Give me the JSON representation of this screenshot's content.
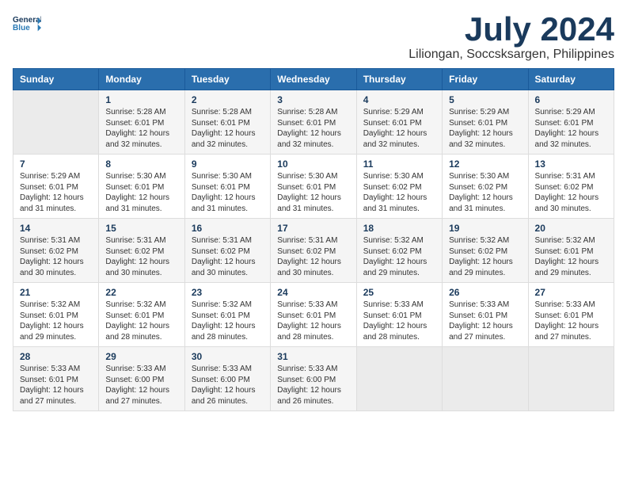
{
  "header": {
    "logo_line1": "General",
    "logo_line2": "Blue",
    "title": "July 2024",
    "subtitle": "Liliongan, Soccsksargen, Philippines"
  },
  "weekdays": [
    "Sunday",
    "Monday",
    "Tuesday",
    "Wednesday",
    "Thursday",
    "Friday",
    "Saturday"
  ],
  "weeks": [
    [
      {
        "day": "",
        "sunrise": "",
        "sunset": "",
        "daylight": "",
        "empty": true
      },
      {
        "day": "1",
        "sunrise": "Sunrise: 5:28 AM",
        "sunset": "Sunset: 6:01 PM",
        "daylight": "Daylight: 12 hours and 32 minutes."
      },
      {
        "day": "2",
        "sunrise": "Sunrise: 5:28 AM",
        "sunset": "Sunset: 6:01 PM",
        "daylight": "Daylight: 12 hours and 32 minutes."
      },
      {
        "day": "3",
        "sunrise": "Sunrise: 5:28 AM",
        "sunset": "Sunset: 6:01 PM",
        "daylight": "Daylight: 12 hours and 32 minutes."
      },
      {
        "day": "4",
        "sunrise": "Sunrise: 5:29 AM",
        "sunset": "Sunset: 6:01 PM",
        "daylight": "Daylight: 12 hours and 32 minutes."
      },
      {
        "day": "5",
        "sunrise": "Sunrise: 5:29 AM",
        "sunset": "Sunset: 6:01 PM",
        "daylight": "Daylight: 12 hours and 32 minutes."
      },
      {
        "day": "6",
        "sunrise": "Sunrise: 5:29 AM",
        "sunset": "Sunset: 6:01 PM",
        "daylight": "Daylight: 12 hours and 32 minutes."
      }
    ],
    [
      {
        "day": "7",
        "sunrise": "Sunrise: 5:29 AM",
        "sunset": "Sunset: 6:01 PM",
        "daylight": "Daylight: 12 hours and 31 minutes."
      },
      {
        "day": "8",
        "sunrise": "Sunrise: 5:30 AM",
        "sunset": "Sunset: 6:01 PM",
        "daylight": "Daylight: 12 hours and 31 minutes."
      },
      {
        "day": "9",
        "sunrise": "Sunrise: 5:30 AM",
        "sunset": "Sunset: 6:01 PM",
        "daylight": "Daylight: 12 hours and 31 minutes."
      },
      {
        "day": "10",
        "sunrise": "Sunrise: 5:30 AM",
        "sunset": "Sunset: 6:01 PM",
        "daylight": "Daylight: 12 hours and 31 minutes."
      },
      {
        "day": "11",
        "sunrise": "Sunrise: 5:30 AM",
        "sunset": "Sunset: 6:02 PM",
        "daylight": "Daylight: 12 hours and 31 minutes."
      },
      {
        "day": "12",
        "sunrise": "Sunrise: 5:30 AM",
        "sunset": "Sunset: 6:02 PM",
        "daylight": "Daylight: 12 hours and 31 minutes."
      },
      {
        "day": "13",
        "sunrise": "Sunrise: 5:31 AM",
        "sunset": "Sunset: 6:02 PM",
        "daylight": "Daylight: 12 hours and 30 minutes."
      }
    ],
    [
      {
        "day": "14",
        "sunrise": "Sunrise: 5:31 AM",
        "sunset": "Sunset: 6:02 PM",
        "daylight": "Daylight: 12 hours and 30 minutes."
      },
      {
        "day": "15",
        "sunrise": "Sunrise: 5:31 AM",
        "sunset": "Sunset: 6:02 PM",
        "daylight": "Daylight: 12 hours and 30 minutes."
      },
      {
        "day": "16",
        "sunrise": "Sunrise: 5:31 AM",
        "sunset": "Sunset: 6:02 PM",
        "daylight": "Daylight: 12 hours and 30 minutes."
      },
      {
        "day": "17",
        "sunrise": "Sunrise: 5:31 AM",
        "sunset": "Sunset: 6:02 PM",
        "daylight": "Daylight: 12 hours and 30 minutes."
      },
      {
        "day": "18",
        "sunrise": "Sunrise: 5:32 AM",
        "sunset": "Sunset: 6:02 PM",
        "daylight": "Daylight: 12 hours and 29 minutes."
      },
      {
        "day": "19",
        "sunrise": "Sunrise: 5:32 AM",
        "sunset": "Sunset: 6:02 PM",
        "daylight": "Daylight: 12 hours and 29 minutes."
      },
      {
        "day": "20",
        "sunrise": "Sunrise: 5:32 AM",
        "sunset": "Sunset: 6:01 PM",
        "daylight": "Daylight: 12 hours and 29 minutes."
      }
    ],
    [
      {
        "day": "21",
        "sunrise": "Sunrise: 5:32 AM",
        "sunset": "Sunset: 6:01 PM",
        "daylight": "Daylight: 12 hours and 29 minutes."
      },
      {
        "day": "22",
        "sunrise": "Sunrise: 5:32 AM",
        "sunset": "Sunset: 6:01 PM",
        "daylight": "Daylight: 12 hours and 28 minutes."
      },
      {
        "day": "23",
        "sunrise": "Sunrise: 5:32 AM",
        "sunset": "Sunset: 6:01 PM",
        "daylight": "Daylight: 12 hours and 28 minutes."
      },
      {
        "day": "24",
        "sunrise": "Sunrise: 5:33 AM",
        "sunset": "Sunset: 6:01 PM",
        "daylight": "Daylight: 12 hours and 28 minutes."
      },
      {
        "day": "25",
        "sunrise": "Sunrise: 5:33 AM",
        "sunset": "Sunset: 6:01 PM",
        "daylight": "Daylight: 12 hours and 28 minutes."
      },
      {
        "day": "26",
        "sunrise": "Sunrise: 5:33 AM",
        "sunset": "Sunset: 6:01 PM",
        "daylight": "Daylight: 12 hours and 27 minutes."
      },
      {
        "day": "27",
        "sunrise": "Sunrise: 5:33 AM",
        "sunset": "Sunset: 6:01 PM",
        "daylight": "Daylight: 12 hours and 27 minutes."
      }
    ],
    [
      {
        "day": "28",
        "sunrise": "Sunrise: 5:33 AM",
        "sunset": "Sunset: 6:01 PM",
        "daylight": "Daylight: 12 hours and 27 minutes."
      },
      {
        "day": "29",
        "sunrise": "Sunrise: 5:33 AM",
        "sunset": "Sunset: 6:00 PM",
        "daylight": "Daylight: 12 hours and 27 minutes."
      },
      {
        "day": "30",
        "sunrise": "Sunrise: 5:33 AM",
        "sunset": "Sunset: 6:00 PM",
        "daylight": "Daylight: 12 hours and 26 minutes."
      },
      {
        "day": "31",
        "sunrise": "Sunrise: 5:33 AM",
        "sunset": "Sunset: 6:00 PM",
        "daylight": "Daylight: 12 hours and 26 minutes."
      },
      {
        "day": "",
        "sunrise": "",
        "sunset": "",
        "daylight": "",
        "empty": true
      },
      {
        "day": "",
        "sunrise": "",
        "sunset": "",
        "daylight": "",
        "empty": true
      },
      {
        "day": "",
        "sunrise": "",
        "sunset": "",
        "daylight": "",
        "empty": true
      }
    ]
  ]
}
